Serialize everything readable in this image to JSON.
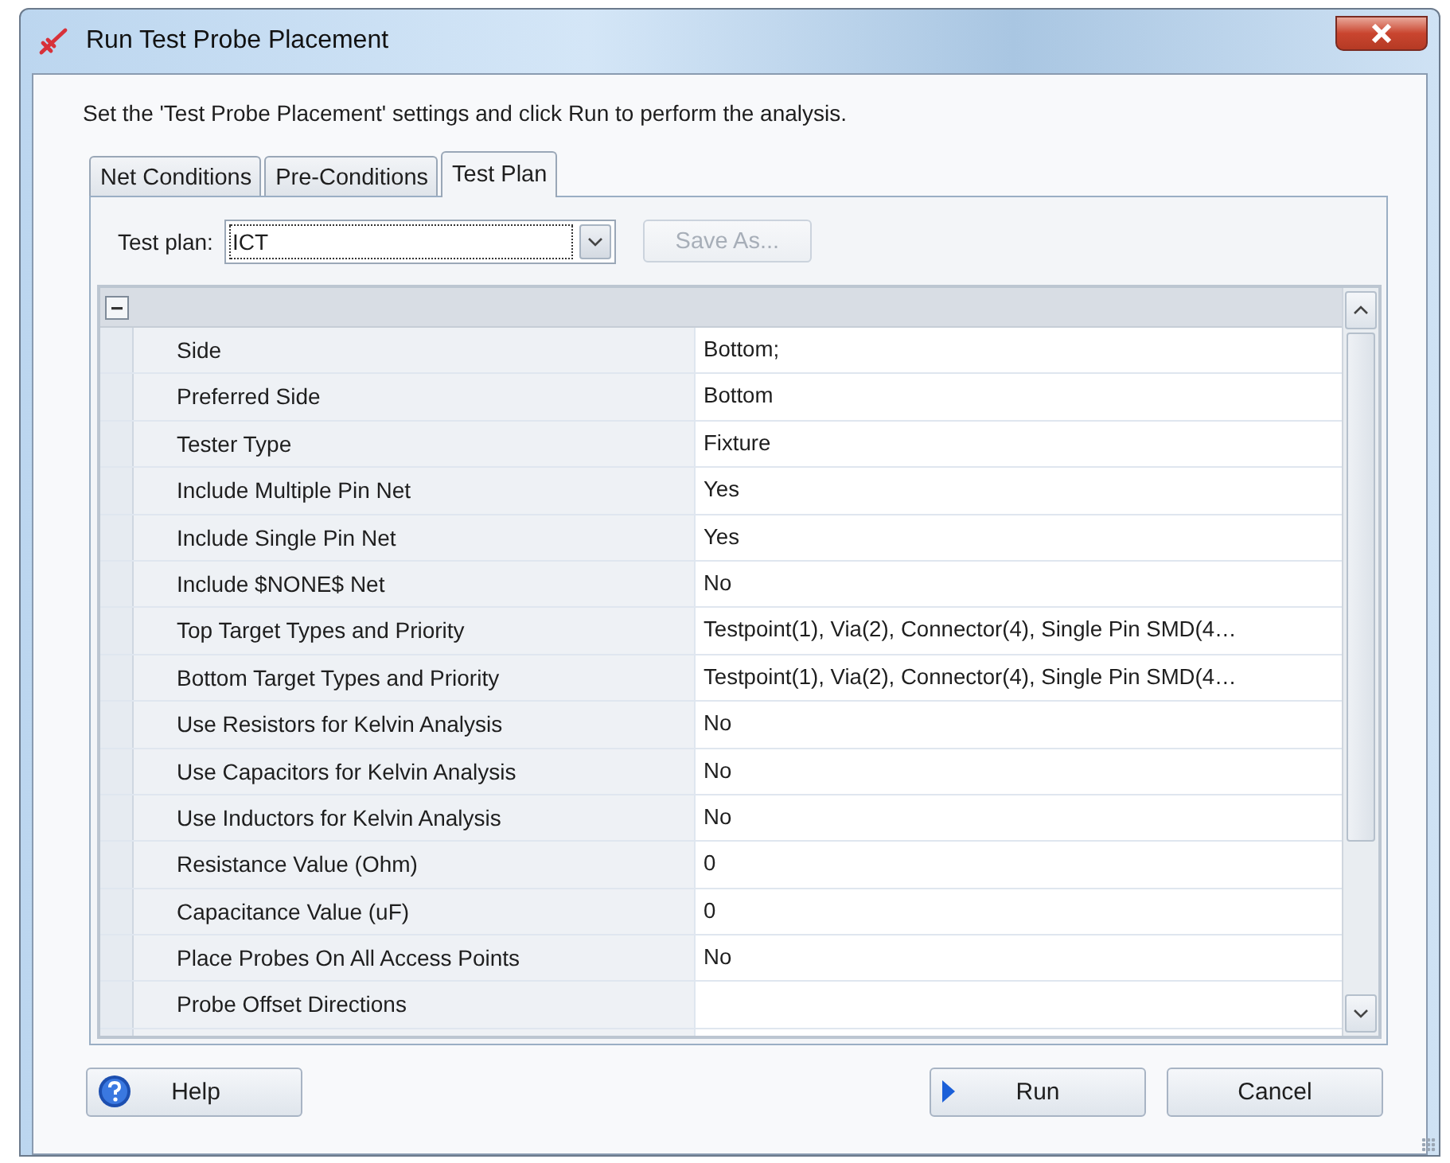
{
  "window": {
    "title": "Run Test Probe Placement"
  },
  "intro": "Set the 'Test Probe Placement' settings and click Run to perform the analysis.",
  "tabs": [
    {
      "label": "Net Conditions",
      "selected": false
    },
    {
      "label": "Pre-Conditions",
      "selected": false
    },
    {
      "label": "Test Plan",
      "selected": true
    }
  ],
  "test_plan": {
    "label": "Test plan:",
    "value": "ICT",
    "save_as": {
      "label": "Save As...",
      "disabled": true
    }
  },
  "grid": {
    "group": {
      "expanded": true
    },
    "rows": [
      {
        "name": "Side",
        "value": "Bottom;"
      },
      {
        "name": "Preferred Side",
        "value": "Bottom"
      },
      {
        "name": "Tester Type",
        "value": "Fixture"
      },
      {
        "name": "Include Multiple Pin Net",
        "value": "Yes"
      },
      {
        "name": "Include Single Pin Net",
        "value": "Yes"
      },
      {
        "name": "Include $NONE$ Net",
        "value": "No"
      },
      {
        "name": "Top Target Types and Priority",
        "value": "Testpoint(1), Via(2), Connector(4), Single Pin SMD(4…"
      },
      {
        "name": "Bottom Target Types and Priority",
        "value": "Testpoint(1), Via(2), Connector(4), Single Pin SMD(4…"
      },
      {
        "name": "Use Resistors for Kelvin Analysis",
        "value": "No"
      },
      {
        "name": "Use Capacitors for Kelvin Analysis",
        "value": "No"
      },
      {
        "name": "Use Inductors for Kelvin Analysis",
        "value": "No"
      },
      {
        "name": "Resistance Value (Ohm)",
        "value": "0"
      },
      {
        "name": "Capacitance Value (uF)",
        "value": "0"
      },
      {
        "name": "Place Probes On All Access Points",
        "value": "No"
      },
      {
        "name": "Probe Offset Directions",
        "value": ""
      }
    ]
  },
  "buttons": [
    {
      "kind": "help",
      "label": "Help"
    },
    {
      "kind": "run",
      "label": "Run"
    },
    {
      "kind": "cancel",
      "label": "Cancel"
    }
  ]
}
